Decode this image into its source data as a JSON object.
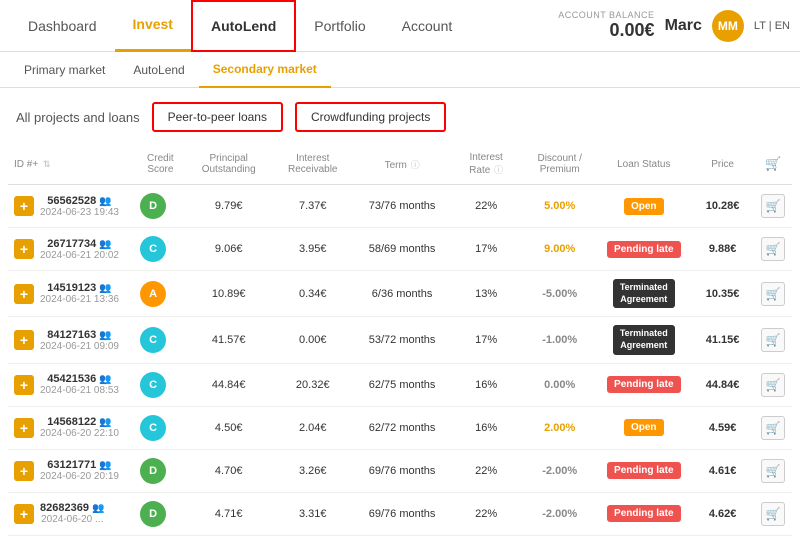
{
  "nav": {
    "items": [
      {
        "label": "Dashboard",
        "id": "dashboard",
        "active": false
      },
      {
        "label": "Invest",
        "id": "invest",
        "active": true
      },
      {
        "label": "AutoLend",
        "id": "autolend",
        "active": false
      },
      {
        "label": "Portfolio",
        "id": "portfolio",
        "active": false
      },
      {
        "label": "Account",
        "id": "account",
        "active": false
      }
    ],
    "balance_label": "ACCOUNT BALANCE",
    "balance": "0.00€",
    "user": "Marc",
    "avatar": "MM",
    "lang": "LT | EN"
  },
  "secondary_nav": {
    "items": [
      {
        "label": "Primary market",
        "active": false
      },
      {
        "label": "AutoLend",
        "active": false
      },
      {
        "label": "Secondary market",
        "active": true
      }
    ]
  },
  "filter": {
    "label": "All projects and loans",
    "btn1": "Peer-to-peer loans",
    "btn2": "Crowdfunding projects"
  },
  "table": {
    "headers": [
      {
        "label": "ID #+",
        "sort": true
      },
      {
        "label": "Credit Score"
      },
      {
        "label": "Principal Outstanding"
      },
      {
        "label": "Interest Receivable"
      },
      {
        "label": "Term",
        "info": true
      },
      {
        "label": "Interest Rate",
        "info": true
      },
      {
        "label": "Discount / Premium"
      },
      {
        "label": "Loan Status"
      },
      {
        "label": "Price"
      },
      {
        "label": ""
      }
    ],
    "rows": [
      {
        "id": "56562528",
        "date": "2024-06-23 19:43",
        "credit": "D",
        "credit_class": "badge-d",
        "principal": "9.79€",
        "interest": "7.37€",
        "term": "73/76 months",
        "rate": "22%",
        "discount": "5.00%",
        "discount_color": "#e8a000",
        "status": "Open",
        "status_class": "status-open",
        "status_label": "Open",
        "price": "10.28€"
      },
      {
        "id": "26717734",
        "date": "2024-06-21 20:02",
        "credit": "C",
        "credit_class": "badge-c",
        "principal": "9.06€",
        "interest": "3.95€",
        "term": "58/69 months",
        "rate": "17%",
        "discount": "9.00%",
        "discount_color": "#e8a000",
        "status": "Pending late",
        "status_class": "status-pending",
        "status_label": "Pending late",
        "price": "9.88€"
      },
      {
        "id": "14519123",
        "date": "2024-06-21 13:36",
        "credit": "A",
        "credit_class": "badge-a",
        "principal": "10.89€",
        "interest": "0.34€",
        "term": "6/36 months",
        "rate": "13%",
        "discount": "-5.00%",
        "discount_color": "#888",
        "status": "Terminated Agreement",
        "status_class": "status-terminated",
        "status_label": "Terminated Agreement",
        "price": "10.35€"
      },
      {
        "id": "84127163",
        "date": "2024-06-21 09:09",
        "credit": "C",
        "credit_class": "badge-c",
        "principal": "41.57€",
        "interest": "0.00€",
        "term": "53/72 months",
        "rate": "17%",
        "discount": "-1.00%",
        "discount_color": "#888",
        "status": "Terminated Agreement",
        "status_class": "status-terminated",
        "status_label": "Terminated Agreement",
        "price": "41.15€"
      },
      {
        "id": "45421536",
        "date": "2024-06-21 08:53",
        "credit": "C",
        "credit_class": "badge-c",
        "principal": "44.84€",
        "interest": "20.32€",
        "term": "62/75 months",
        "rate": "16%",
        "discount": "0.00%",
        "discount_color": "#888",
        "status": "Pending late",
        "status_class": "status-pending",
        "status_label": "Pending late",
        "price": "44.84€"
      },
      {
        "id": "14568122",
        "date": "2024-06-20 22:10",
        "credit": "C",
        "credit_class": "badge-c",
        "principal": "4.50€",
        "interest": "2.04€",
        "term": "62/72 months",
        "rate": "16%",
        "discount": "2.00%",
        "discount_color": "#e8a000",
        "status": "Open",
        "status_class": "status-open",
        "status_label": "Open",
        "price": "4.59€"
      },
      {
        "id": "63121771",
        "date": "2024-06-20 20:19",
        "credit": "D",
        "credit_class": "badge-d",
        "principal": "4.70€",
        "interest": "3.26€",
        "term": "69/76 months",
        "rate": "22%",
        "discount": "-2.00%",
        "discount_color": "#888",
        "status": "Pending late",
        "status_class": "status-pending",
        "status_label": "Pending late",
        "price": "4.61€"
      },
      {
        "id": "82682369",
        "date": "2024-06-20 ...",
        "credit": "D",
        "credit_class": "badge-d",
        "principal": "4.71€",
        "interest": "3.31€",
        "term": "69/76 months",
        "rate": "22%",
        "discount": "-2.00%",
        "discount_color": "#888",
        "status": "Pending late",
        "status_class": "status-pending",
        "status_label": "Pending late",
        "price": "4.62€"
      }
    ]
  }
}
